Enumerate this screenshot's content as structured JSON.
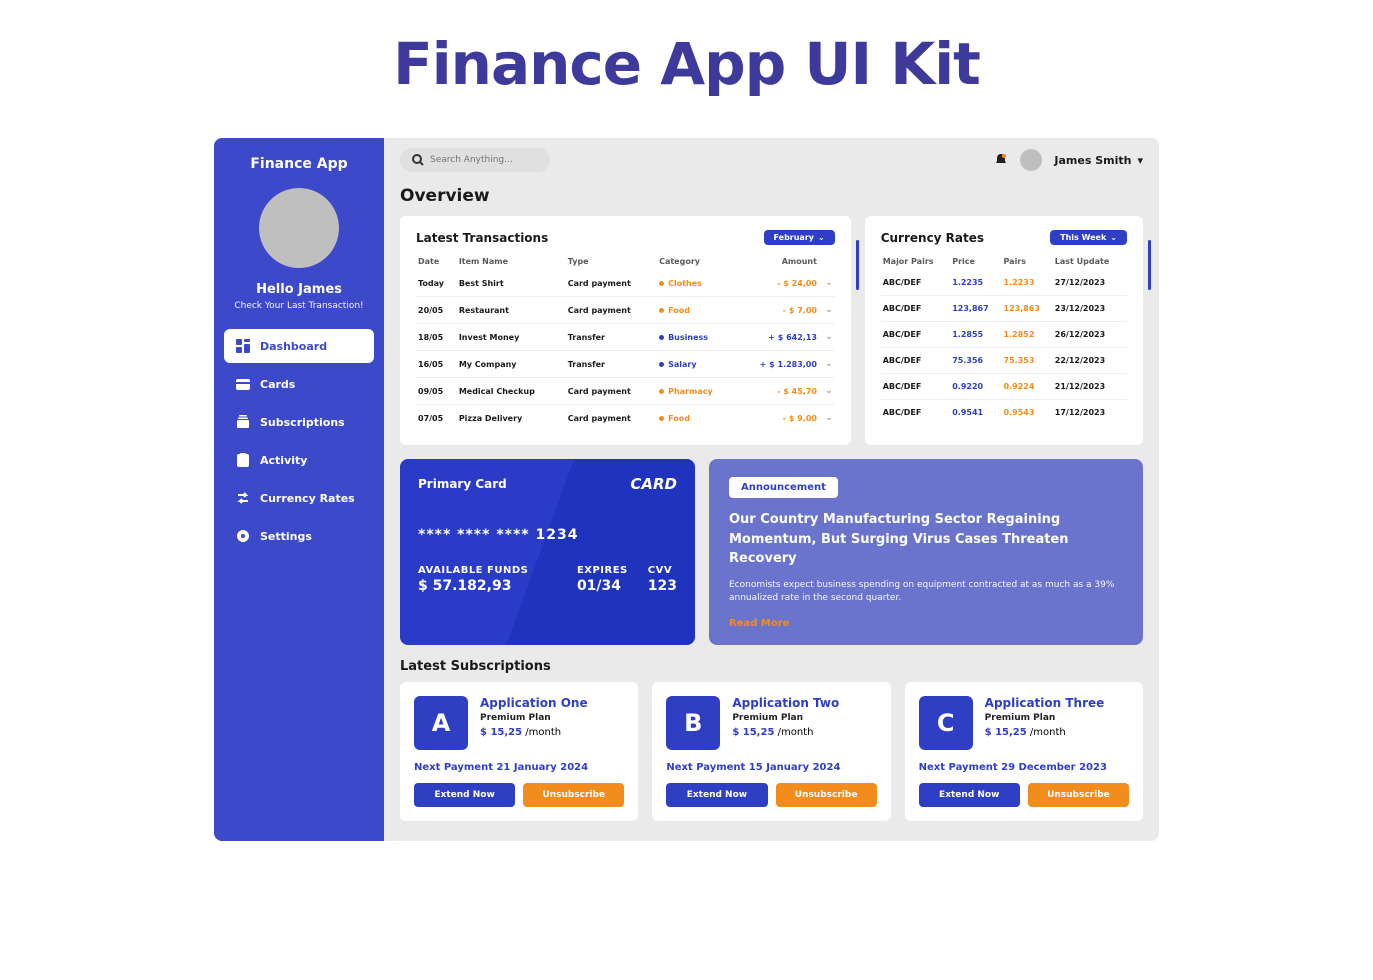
{
  "pageTitle": "Finance App UI Kit",
  "sidebar": {
    "title": "Finance App",
    "greeting": "Hello James",
    "greetSub": "Check Your Last Transaction!",
    "items": [
      {
        "label": "Dashboard"
      },
      {
        "label": "Cards"
      },
      {
        "label": "Subscriptions"
      },
      {
        "label": "Activity"
      },
      {
        "label": "Currency Rates"
      },
      {
        "label": "Settings"
      }
    ]
  },
  "header": {
    "searchPlaceholder": "Search Anything...",
    "userName": "James Smith"
  },
  "overview": {
    "title": "Overview"
  },
  "transactions": {
    "title": "Latest Transactions",
    "filter": "February",
    "headers": {
      "date": "Date",
      "name": "Item Name",
      "type": "Type",
      "category": "Category",
      "amount": "Amount"
    },
    "rows": [
      {
        "date": "Today",
        "name": "Best Shirt",
        "type": "Card payment",
        "category": "Clothes",
        "catColor": "#f28c1c",
        "amount": "- $ 24,00",
        "sign": "neg"
      },
      {
        "date": "20/05",
        "name": "Restaurant",
        "type": "Card payment",
        "category": "Food",
        "catColor": "#f28c1c",
        "amount": "- $ 7,00",
        "sign": "neg"
      },
      {
        "date": "18/05",
        "name": "Invest Money",
        "type": "Transfer",
        "category": "Business",
        "catColor": "#2f3fc4",
        "amount": "+ $ 642,13",
        "sign": "pos"
      },
      {
        "date": "16/05",
        "name": "My Company",
        "type": "Transfer",
        "category": "Salary",
        "catColor": "#2f3fc4",
        "amount": "+ $ 1.283,00",
        "sign": "pos"
      },
      {
        "date": "09/05",
        "name": "Medical Checkup",
        "type": "Card payment",
        "category": "Pharmacy",
        "catColor": "#f28c1c",
        "amount": "- $ 45,70",
        "sign": "neg"
      },
      {
        "date": "07/05",
        "name": "Pizza Delivery",
        "type": "Card payment",
        "category": "Food",
        "catColor": "#f28c1c",
        "amount": "- $ 9,00",
        "sign": "neg"
      }
    ]
  },
  "rates": {
    "title": "Currency Rates",
    "filter": "This Week",
    "headers": {
      "pair": "Major Pairs",
      "price": "Price",
      "pairs": "Pairs",
      "update": "Last Update"
    },
    "rows": [
      {
        "pair": "ABC/DEF",
        "price": "1.2235",
        "pairs": "1.2233",
        "update": "27/12/2023"
      },
      {
        "pair": "ABC/DEF",
        "price": "123,867",
        "pairs": "123,863",
        "update": "23/12/2023"
      },
      {
        "pair": "ABC/DEF",
        "price": "1.2855",
        "pairs": "1.2852",
        "update": "26/12/2023"
      },
      {
        "pair": "ABC/DEF",
        "price": "75.356",
        "pairs": "75.353",
        "update": "22/12/2023"
      },
      {
        "pair": "ABC/DEF",
        "price": "0.9220",
        "pairs": "0.9224",
        "update": "21/12/2023"
      },
      {
        "pair": "ABC/DEF",
        "price": "0.9541",
        "pairs": "0.9543",
        "update": "17/12/2023"
      }
    ]
  },
  "card": {
    "label": "Primary Card",
    "brand": "CARD",
    "number": "**** **** ****   1234",
    "funds": {
      "k": "AVAILABLE FUNDS",
      "v": "$ 57.182,93"
    },
    "exp": {
      "k": "EXPIRES",
      "v": "01/34"
    },
    "cvv": {
      "k": "CVV",
      "v": "123"
    }
  },
  "announce": {
    "tag": "Announcement",
    "headline": "Our Country Manufacturing Sector Regaining Momentum, But Surging Virus Cases Threaten Recovery",
    "body": "Economists expect business spending on equipment contracted at as much as a 39% annualized rate in the second quarter.",
    "more": "Read More"
  },
  "subs": {
    "title": "Latest Subscriptions",
    "nextLabel": "Next Payment",
    "extend": "Extend Now",
    "unsub": "Unsubscribe",
    "period": "/month",
    "list": [
      {
        "letter": "A",
        "name": "Application One",
        "plan": "Premium Plan",
        "price": "$ 15,25",
        "next": "21 January 2024"
      },
      {
        "letter": "B",
        "name": "Application Two",
        "plan": "Premium Plan",
        "price": "$ 15,25",
        "next": "15 January 2024"
      },
      {
        "letter": "C",
        "name": "Application Three",
        "plan": "Premium Plan",
        "price": "$ 15,25",
        "next": "29 December 2023"
      }
    ]
  }
}
